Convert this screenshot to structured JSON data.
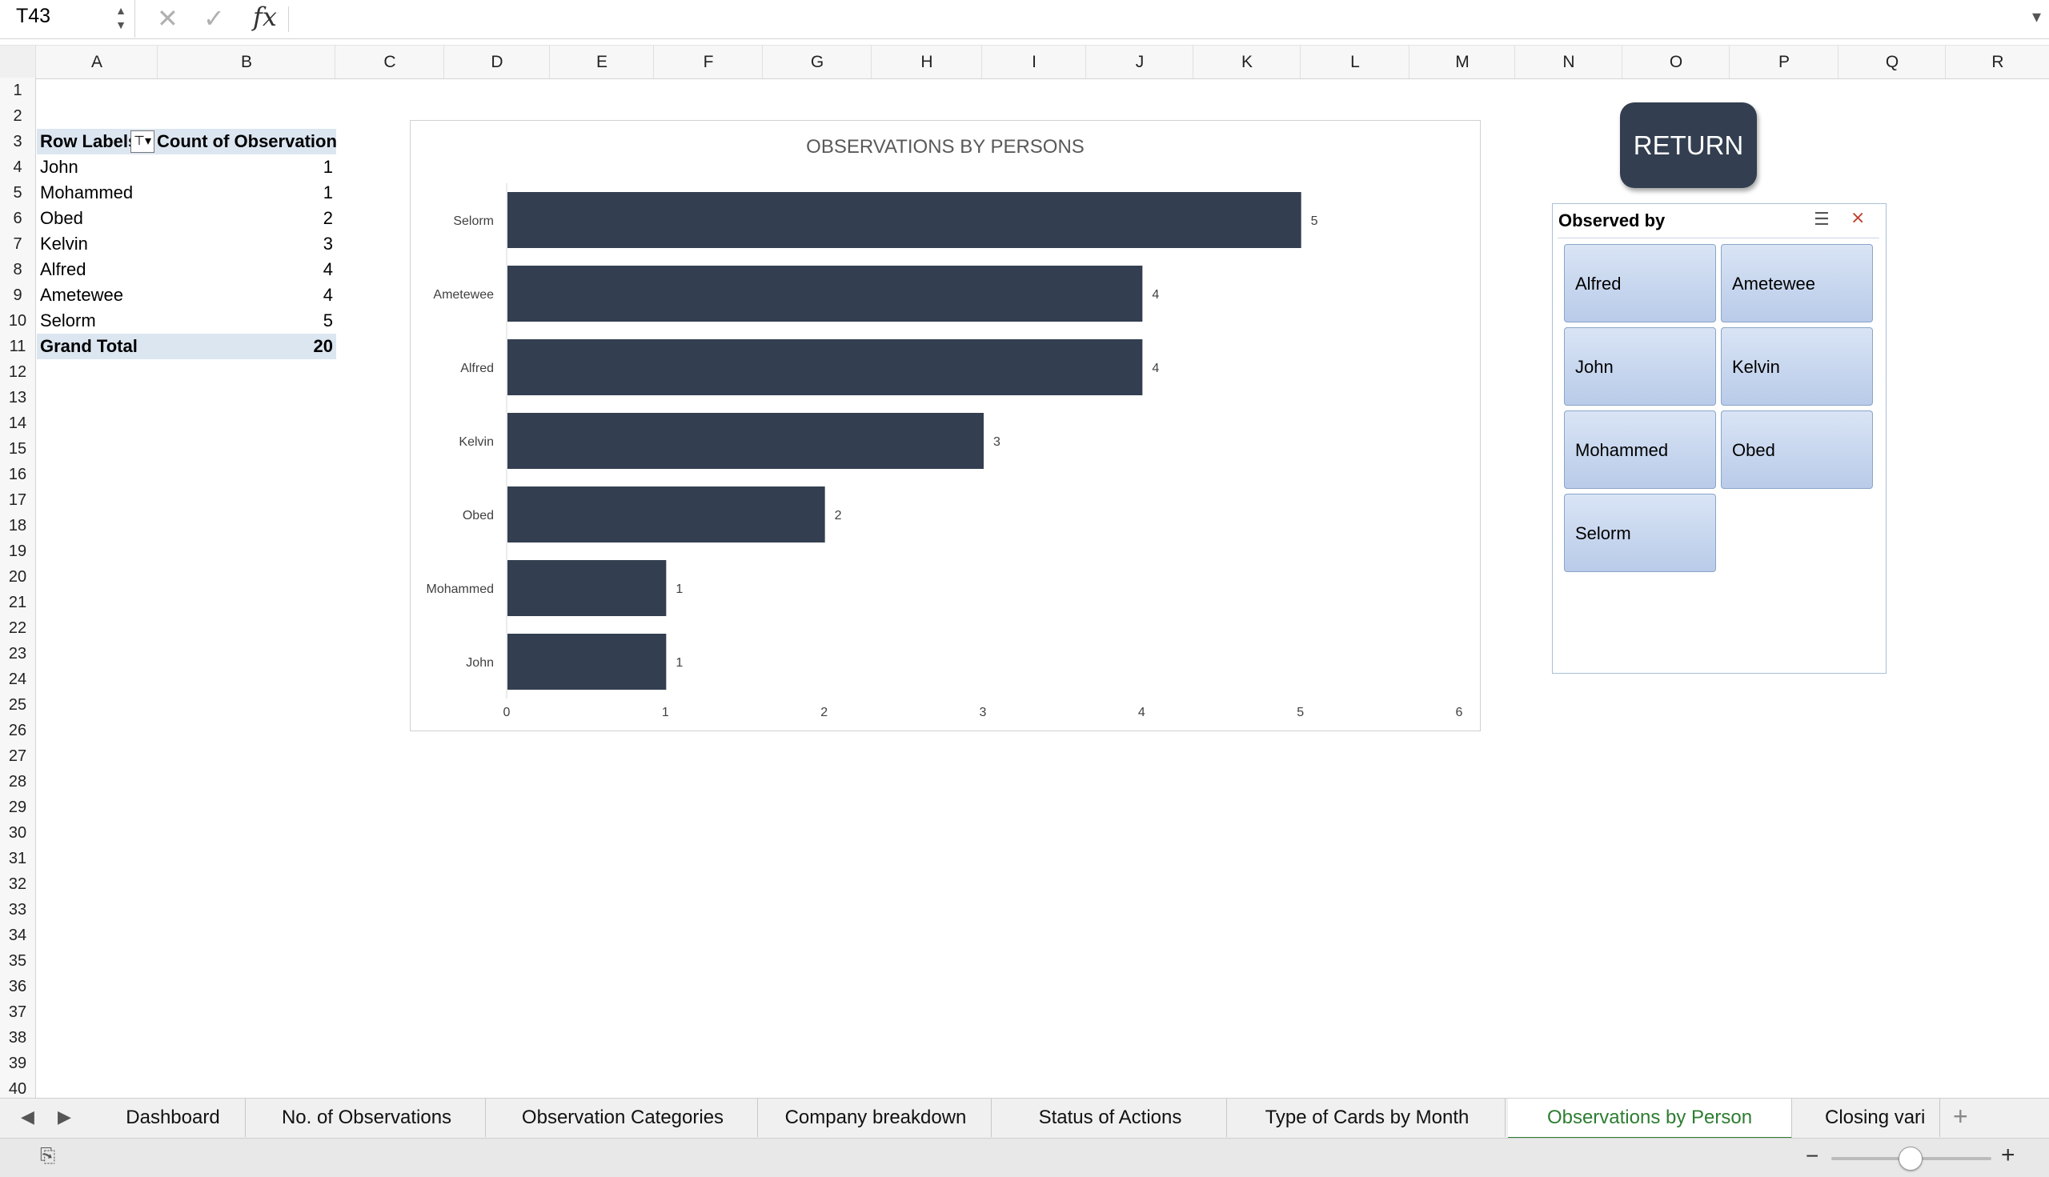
{
  "formula_bar": {
    "name_box": "T43",
    "cancel_icon": "x-icon",
    "confirm_icon": "check-icon",
    "function_label": "fx",
    "formula": ""
  },
  "columns": [
    "A",
    "B",
    "C",
    "D",
    "E",
    "F",
    "G",
    "H",
    "I",
    "J",
    "K",
    "L",
    "M",
    "N",
    "O",
    "P",
    "Q",
    "R"
  ],
  "rows": [
    "1",
    "2",
    "3",
    "4",
    "5",
    "6",
    "7",
    "8",
    "9",
    "10",
    "11",
    "12",
    "13",
    "14",
    "15",
    "16",
    "17",
    "18",
    "19",
    "20",
    "21",
    "22",
    "23",
    "24",
    "25",
    "26",
    "27",
    "28",
    "29",
    "30",
    "31",
    "32",
    "33",
    "34",
    "35",
    "36",
    "37",
    "38",
    "39",
    "40"
  ],
  "pivot": {
    "header_label": "Row Labels",
    "header_value": "Count of Observation",
    "rows": [
      {
        "label": "John",
        "value": "1"
      },
      {
        "label": "Mohammed",
        "value": "1"
      },
      {
        "label": "Obed",
        "value": "2"
      },
      {
        "label": "Kelvin",
        "value": "3"
      },
      {
        "label": "Alfred",
        "value": "4"
      },
      {
        "label": "Ametewee",
        "value": "4"
      },
      {
        "label": "Selorm",
        "value": "5"
      }
    ],
    "total_label": "Grand Total",
    "total_value": "20"
  },
  "chart_data": {
    "type": "bar",
    "orientation": "horizontal",
    "title": "OBSERVATIONS BY PERSONS",
    "categories": [
      "Selorm",
      "Ametewee",
      "Alfred",
      "Kelvin",
      "Obed",
      "Mohammed",
      "John"
    ],
    "values": [
      5,
      4,
      4,
      3,
      2,
      1,
      1
    ],
    "xlim": [
      0,
      6
    ],
    "xticks": [
      "0",
      "1",
      "2",
      "3",
      "4",
      "5",
      "6"
    ],
    "bar_color": "#333f50",
    "data_labels": true,
    "grid": false
  },
  "return_button": "RETURN",
  "slicer": {
    "title": "Observed by",
    "items": [
      "Alfred",
      "Ametewee",
      "John",
      "Kelvin",
      "Mohammed",
      "Obed",
      "Selorm"
    ]
  },
  "sheet_tabs": [
    {
      "label": "Dashboard",
      "active": false
    },
    {
      "label": "No. of Observations",
      "active": false
    },
    {
      "label": "Observation Categories",
      "active": false
    },
    {
      "label": "Company breakdown",
      "active": false
    },
    {
      "label": "Status of Actions",
      "active": false
    },
    {
      "label": "Type of Cards by Month",
      "active": false
    },
    {
      "label": "Observations by Person",
      "active": true
    },
    {
      "label": "Closing vari",
      "active": false
    }
  ],
  "colors": {
    "accent_green": "#2e7d32",
    "pivot_header_fill": "#dce6f1",
    "bar": "#333f50"
  }
}
